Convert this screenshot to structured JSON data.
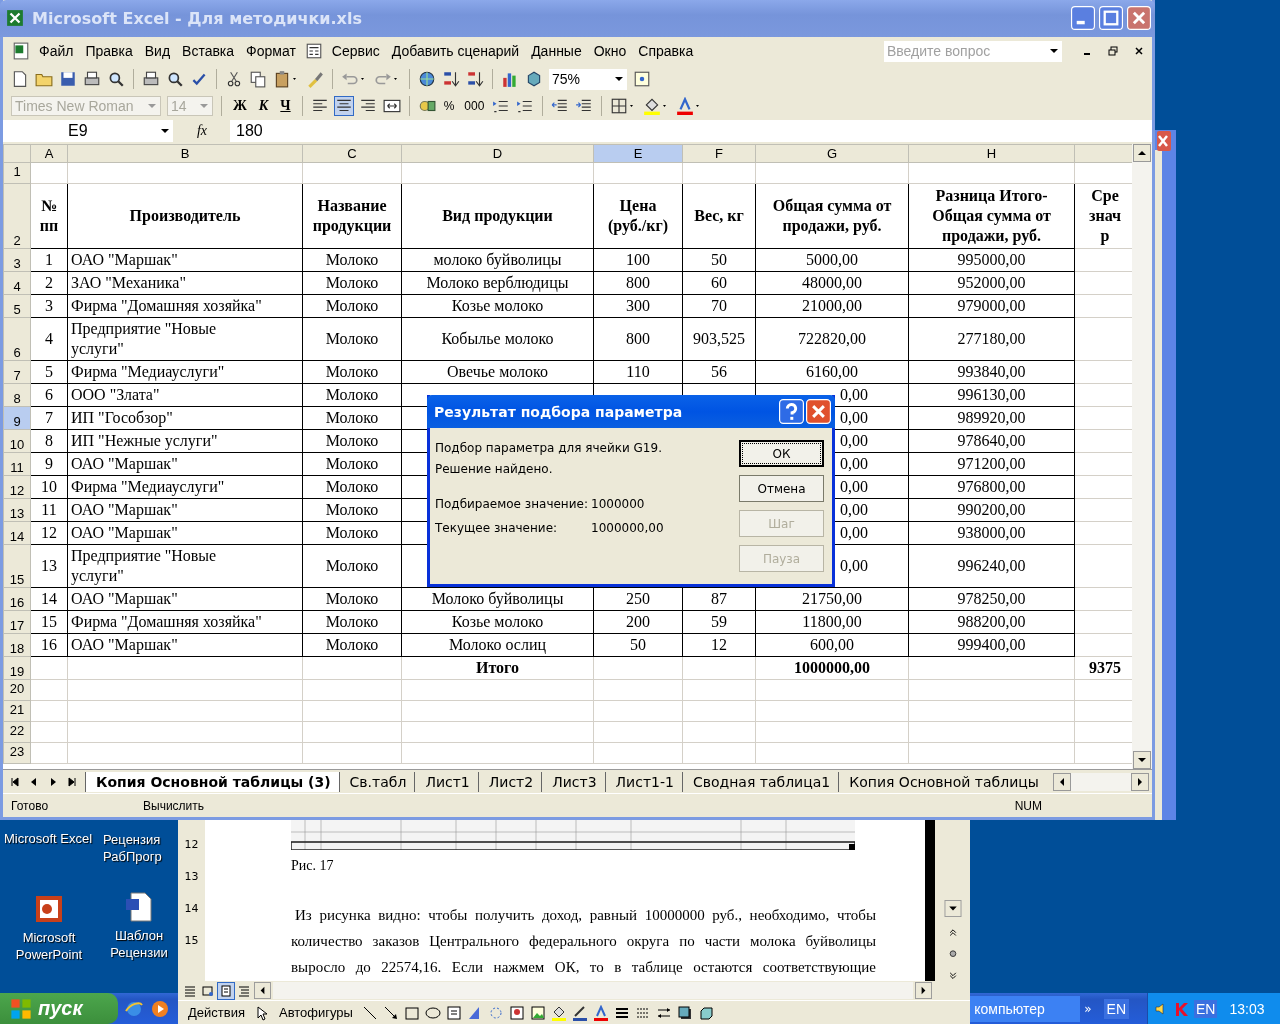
{
  "excel": {
    "title": "Microsoft Excel - Для методички.xls",
    "menu": [
      "Файл",
      "Правка",
      "Вид",
      "Вставка",
      "Формат",
      "Сервис",
      "Добавить сценарий",
      "Данные",
      "Окно",
      "Справка"
    ],
    "help_search": {
      "placeholder": "Введите вопрос"
    },
    "zoom": "75%",
    "font": {
      "name": "Times New Roman",
      "size": "14",
      "disabled": true
    },
    "style_buttons": [
      "Ж",
      "К",
      "Ч"
    ],
    "align_buttons": [
      {
        "selected": false
      },
      {
        "selected": true
      },
      {
        "selected": false
      }
    ],
    "number_buttons": [
      "%",
      "000"
    ],
    "name_box": "E9",
    "function_icon": "fx",
    "formula": "180",
    "columns": [
      {
        "label": "A",
        "selected": false
      },
      {
        "label": "B",
        "selected": false
      },
      {
        "label": "C",
        "selected": false
      },
      {
        "label": "D",
        "selected": false
      },
      {
        "label": "E",
        "selected": true
      },
      {
        "label": "F",
        "selected": false
      },
      {
        "label": "G",
        "selected": false
      },
      {
        "label": "H",
        "selected": false
      },
      {
        "selected": false
      }
    ],
    "rows": [
      {
        "n": "1",
        "kind": "empty",
        "selected": false
      },
      {
        "n": "2",
        "kind": "header",
        "selected": false,
        "cells": [
          "№ пп",
          "Производитель",
          "Название продукции",
          "Вид продукции",
          "Цена\n(руб./кг)",
          "Вес, кг",
          "Общая сумма от продажи, руб.",
          "Разница Итого-Общая сумма от продажи, руб.",
          "Сре\nзнач\nр"
        ]
      },
      {
        "n": "3",
        "kind": "data",
        "selected": false,
        "cells": [
          "1",
          "ОАО \"Маршак\"",
          "Молоко",
          "молоко буйволицы",
          "100",
          "50",
          "5000,00",
          "995000,00",
          null
        ]
      },
      {
        "n": "4",
        "kind": "data",
        "selected": false,
        "cells": [
          "2",
          "ЗАО \"Механика\"",
          "Молоко",
          "Молоко верблюдицы",
          "800",
          "60",
          "48000,00",
          "952000,00",
          null
        ]
      },
      {
        "n": "5",
        "kind": "data",
        "selected": false,
        "cells": [
          "3",
          "Фирма \"Домашняя хозяйка\"",
          "Молоко",
          "Козье молоко",
          "300",
          "70",
          "21000,00",
          "979000,00",
          null
        ]
      },
      {
        "n": "6",
        "kind": "data",
        "selected": false,
        "cells": [
          "4",
          "Предприятие \"Новые услуги\"",
          "Молоко",
          "Кобылье молоко",
          "800",
          "903,525",
          "722820,00",
          "277180,00",
          null
        ]
      },
      {
        "n": "7",
        "kind": "data",
        "selected": false,
        "cells": [
          "5",
          "Фирма \"Медиауслуги\"",
          "Молоко",
          "Овечье молоко",
          "110",
          "56",
          "6160,00",
          "993840,00",
          null
        ]
      },
      {
        "n": "8",
        "kind": "data",
        "selected": false,
        "partial": true,
        "cells": [
          "6",
          "ООО \"Злата\"",
          "Молоко",
          null,
          null,
          null,
          "0,00",
          "996130,00",
          null
        ]
      },
      {
        "n": "9",
        "kind": "data",
        "selected": true,
        "partial": true,
        "cells": [
          "7",
          "ИП \"Гособзор\"",
          "Молоко",
          null,
          null,
          null,
          "0,00",
          "989920,00",
          null
        ]
      },
      {
        "n": "10",
        "kind": "data",
        "selected": false,
        "partial": true,
        "cells": [
          "8",
          "ИП \"Нежные услуги\"",
          "Молоко",
          null,
          null,
          null,
          "0,00",
          "978640,00",
          null
        ]
      },
      {
        "n": "11",
        "kind": "data",
        "selected": false,
        "partial": true,
        "cells": [
          "9",
          "ОАО \"Маршак\"",
          "Молоко",
          null,
          null,
          null,
          "0,00",
          "971200,00",
          null
        ]
      },
      {
        "n": "12",
        "kind": "data",
        "selected": false,
        "partial": true,
        "cells": [
          "10",
          "Фирма \"Медиауслуги\"",
          "Молоко",
          null,
          null,
          null,
          "0,00",
          "976800,00",
          null
        ]
      },
      {
        "n": "13",
        "kind": "data",
        "selected": false,
        "partial": true,
        "cells": [
          "11",
          "ОАО \"Маршак\"",
          "Молоко",
          null,
          null,
          null,
          "0,00",
          "990200,00",
          null
        ]
      },
      {
        "n": "14",
        "kind": "data",
        "selected": false,
        "partial": true,
        "cells": [
          "12",
          "ОАО \"Маршак\"",
          "Молоко",
          null,
          null,
          null,
          "0,00",
          "938000,00",
          null
        ]
      },
      {
        "n": "15",
        "kind": "data",
        "selected": false,
        "partial": true,
        "cells": [
          "13",
          "Предприятие \"Новые услуги\"",
          "Молоко",
          null,
          null,
          null,
          "0,00",
          "996240,00",
          null
        ]
      },
      {
        "n": "16",
        "kind": "data",
        "selected": false,
        "cells": [
          "14",
          "ОАО \"Маршак\"",
          "Молоко",
          "Молоко буйволицы",
          "250",
          "87",
          "21750,00",
          "978250,00",
          null
        ]
      },
      {
        "n": "17",
        "kind": "data",
        "selected": false,
        "cells": [
          "15",
          "Фирма \"Домашняя хозяйка\"",
          "Молоко",
          "Козье молоко",
          "200",
          "59",
          "11800,00",
          "988200,00",
          null
        ]
      },
      {
        "n": "18",
        "kind": "data",
        "selected": false,
        "cells": [
          "16",
          "ОАО \"Маршак\"",
          "Молоко",
          "Молоко ослиц",
          "50",
          "12",
          "600,00",
          "999400,00",
          null
        ]
      },
      {
        "n": "19",
        "kind": "total",
        "selected": false,
        "cells": [
          null,
          null,
          null,
          "Итого",
          null,
          null,
          "1000000,00",
          null,
          "9375"
        ]
      },
      {
        "n": "20",
        "kind": "empty",
        "selected": false
      },
      {
        "n": "21",
        "kind": "empty",
        "selected": false
      },
      {
        "n": "22",
        "kind": "empty",
        "selected": false
      },
      {
        "n": "23",
        "kind": "empty",
        "selected": false
      }
    ],
    "sheet_tabs": [
      {
        "label": "Копия Основной таблицы (3)",
        "selected": true
      },
      {
        "label": "Св.табл",
        "selected": false
      },
      {
        "label": "Лист1",
        "selected": false
      },
      {
        "label": "Лист2",
        "selected": false
      },
      {
        "label": "Лист3",
        "selected": false
      },
      {
        "label": "Лист1-1",
        "selected": false
      },
      {
        "label": "Сводная таблица1",
        "selected": false
      },
      {
        "label": "Копия Основной таблицы",
        "selected": false
      }
    ],
    "status_bar": {
      "left": "Готово",
      "mode": "Вычислить",
      "num": "NUM"
    }
  },
  "dialog": {
    "title": "Результат подбора параметра",
    "lines": [
      "Подбор параметра для ячейки G19.",
      "Решение найдено."
    ],
    "fields": [
      {
        "label": "Подбираемое значение:",
        "value": "1000000"
      },
      {
        "label": "Текущее значение:",
        "value": "1000000,00"
      }
    ],
    "buttons": [
      {
        "label": "ОК",
        "disabled": false,
        "default": true
      },
      {
        "label": "Отмена",
        "disabled": false,
        "default": false
      },
      {
        "label": "Шаг",
        "disabled": true,
        "default": false
      },
      {
        "label": "Пауза",
        "disabled": true,
        "default": false
      }
    ]
  },
  "desktop_icons": [
    {
      "label": "Microsoft Excel",
      "kind": "hidden"
    },
    {
      "label": "Рецензия РабПрогр",
      "kind": "hidden"
    },
    {
      "label": "Microsoft PowerPoint",
      "kind": "powerpoint"
    },
    {
      "label": "Шаблон Рецензии",
      "kind": "word"
    }
  ],
  "word": {
    "ruler": [
      "12",
      "13",
      "14",
      "15"
    ],
    "caption": "Рис. 17",
    "paragraph": "Из рисунка видно: чтобы получить доход, равный 10000000 руб., необходимо, чтобы количество заказов Центрального федерального округа по части молока буйволицы выросло до 22574,16. Если нажмем ОК, то в таблице остаются соответствующие",
    "drawing_toolbar": [
      "Действия",
      "Автофигуры"
    ]
  },
  "taskbar": {
    "start": "пуск",
    "tasks": [
      "компьютер"
    ],
    "chevron": "»",
    "language": "EN",
    "tray_language": "EN",
    "clock": "13:03"
  }
}
